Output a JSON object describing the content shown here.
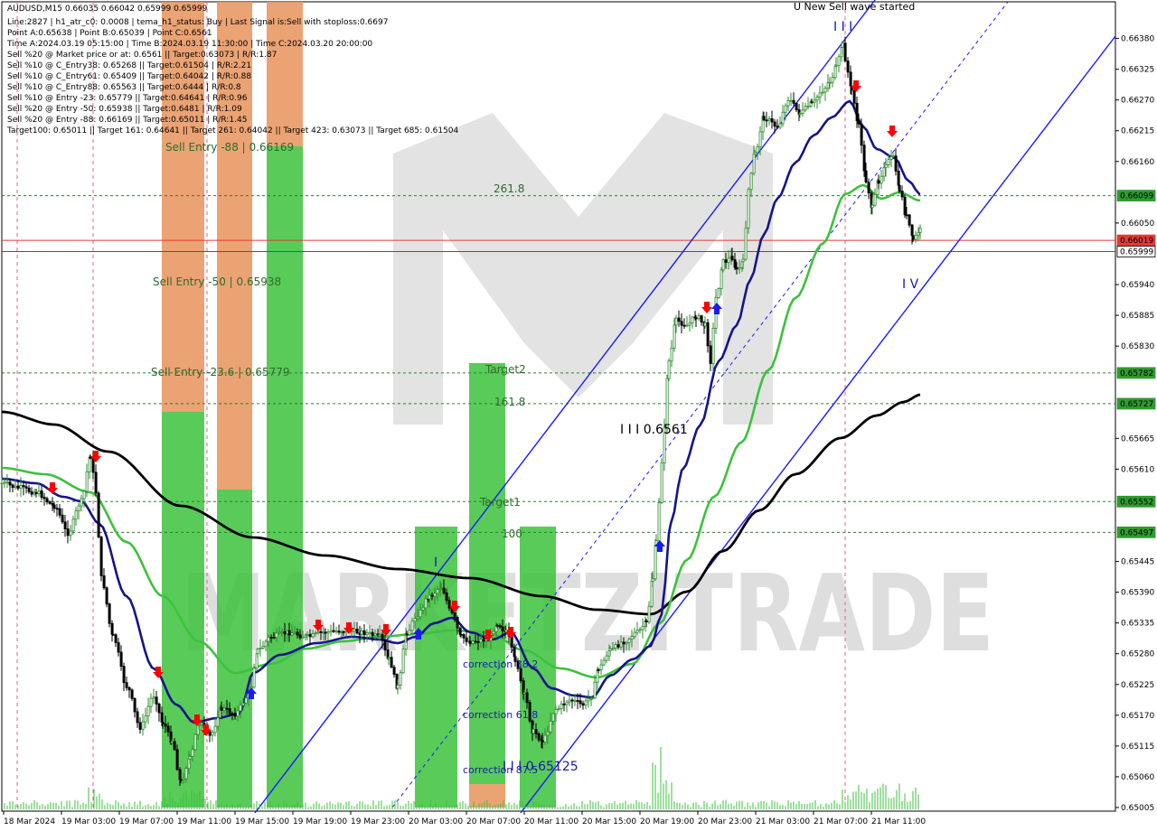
{
  "chart_data": {
    "type": "candlestick",
    "symbol": "AUDUSD,M15",
    "ohlc_header": "AUDUSD,M15  0.66035 0.66042 0.65999 0.65999",
    "ylim": [
      0.65005,
      0.6641
    ],
    "info_lines": [
      "Line:2827 | h1_atr_c0: 0.0008 | tema_h1_status: Buy | Last Signal is:Sell with stoploss:0.6697",
      "Point A:0.65638 | Point B:0.65039 | Point C:0.6561",
      "Time A:2024.03.19 05:15:00 | Time B:2024.03.19 11:30:00 | Time C:2024.03.20 20:00:00",
      "Sell %20 @ Market price or at: 0.6561 || Target:0.63073 | R/R:1.87",
      "Sell %10 @ C_Entry38: 0.65268 || Target:0.61504 | R/R:2.21",
      "Sell %10 @ C_Entry61: 0.65409 || Target:0.64042 | R/R:0.88",
      "Sell %10 @ C_Entry88: 0.65563 || Target:0.6444 | R/R:0.8",
      "Sell %10 @ Entry -23: 0.65779 || Target:0.64641 | R/R:0.96",
      "Sell %20 @ Entry -50: 0.65938 || Target:0.6481 | R/R:1.09",
      "Sell %20 @ Entry -88: 0.66169 || Target:0.65011 | R/R:1.45",
      "Target100: 0.65011 || Target 161: 0.64641 || Target 261: 0.64042 || Target 423: 0.63073 || Target 685: 0.61504"
    ],
    "y_ticks": [
      "0.66380",
      "0.66325",
      "0.66270",
      "0.66215",
      "0.66160",
      "0.66050",
      "0.65940",
      "0.65885",
      "0.65830",
      "0.65665",
      "0.65610",
      "0.65445",
      "0.65390",
      "0.65335",
      "0.65280",
      "0.65225",
      "0.65170",
      "0.65115",
      "0.65060",
      "0.65005"
    ],
    "x_ticks": [
      "18 Mar 2024",
      "19 Mar 03:00",
      "19 Mar 07:00",
      "19 Mar 11:00",
      "19 Mar 15:00",
      "19 Mar 19:00",
      "19 Mar 23:00",
      "20 Mar 03:00",
      "20 Mar 07:00",
      "20 Mar 11:00",
      "20 Mar 15:00",
      "20 Mar 19:00",
      "20 Mar 23:00",
      "21 Mar 03:00",
      "21 Mar 07:00",
      "21 Mar 11:00"
    ],
    "levels": [
      {
        "price": 0.66099,
        "label": "0.66099",
        "color": "#2e7d32",
        "style": "dashed"
      },
      {
        "price": 0.66019,
        "label": "0.66019",
        "color": "#e53935",
        "style": "solid"
      },
      {
        "price": 0.65999,
        "label": "0.65999",
        "color": "#555555",
        "style": "solid"
      },
      {
        "price": 0.65782,
        "label": "0.65782",
        "color": "#2e7d32",
        "style": "dashed"
      },
      {
        "price": 0.65727,
        "label": "0.65727",
        "color": "#2e7d32",
        "style": "dashed"
      },
      {
        "price": 0.65552,
        "label": "0.65552",
        "color": "#2e7d32",
        "style": "dashed"
      },
      {
        "price": 0.65497,
        "label": "0.65497",
        "color": "#2e7d32",
        "style": "dashed"
      }
    ],
    "zone_labels": [
      {
        "text": "Sell Entry -88 | 0.66169",
        "color": "#2e6b2e"
      },
      {
        "text": "Sell Entry -50 | 0.65938",
        "color": "#2e6b2e"
      },
      {
        "text": "Sell Entry -23.6 | 0.65779",
        "color": "#2e6b2e"
      },
      {
        "text": "261.8",
        "color": "#2e6b2e"
      },
      {
        "text": "Target2",
        "color": "#2e6b2e"
      },
      {
        "text": "161.8",
        "color": "#2e6b2e"
      },
      {
        "text": "Target1",
        "color": "#2e6b2e"
      },
      {
        "text": "100",
        "color": "#2e6b2e"
      },
      {
        "text": "correction 38.2",
        "color": "#1a1aa6"
      },
      {
        "text": "correction 61.8",
        "color": "#1a1aa6"
      },
      {
        "text": "correction 87.5",
        "color": "#1a1aa6"
      }
    ],
    "wave_labels": [
      {
        "text": "I I I",
        "color": "#1a1aa6"
      },
      {
        "text": "I V",
        "color": "#1a1aa6"
      },
      {
        "text": "I I I 0.6561",
        "color": "#000000"
      },
      {
        "text": "I I I 0.65125",
        "color": "#1a1aa6"
      },
      {
        "text": "I",
        "color": "#1a1aa6"
      },
      {
        "text": "U New Sell wave started",
        "color": "#000000"
      }
    ],
    "watermark": "MARKETZITRADE",
    "colors": {
      "bull_candle": "#2e8b2e",
      "bear_candle": "#000000",
      "green_zone": "#3cc23c",
      "orange_zone": "#e8935a",
      "channel": "#1a1aff",
      "ma_black": "#000000",
      "ma_navy": "#14148c",
      "ma_green": "#3cc23c",
      "sell_arrow": "#ff0000",
      "buy_arrow": "#1a1aff"
    }
  }
}
